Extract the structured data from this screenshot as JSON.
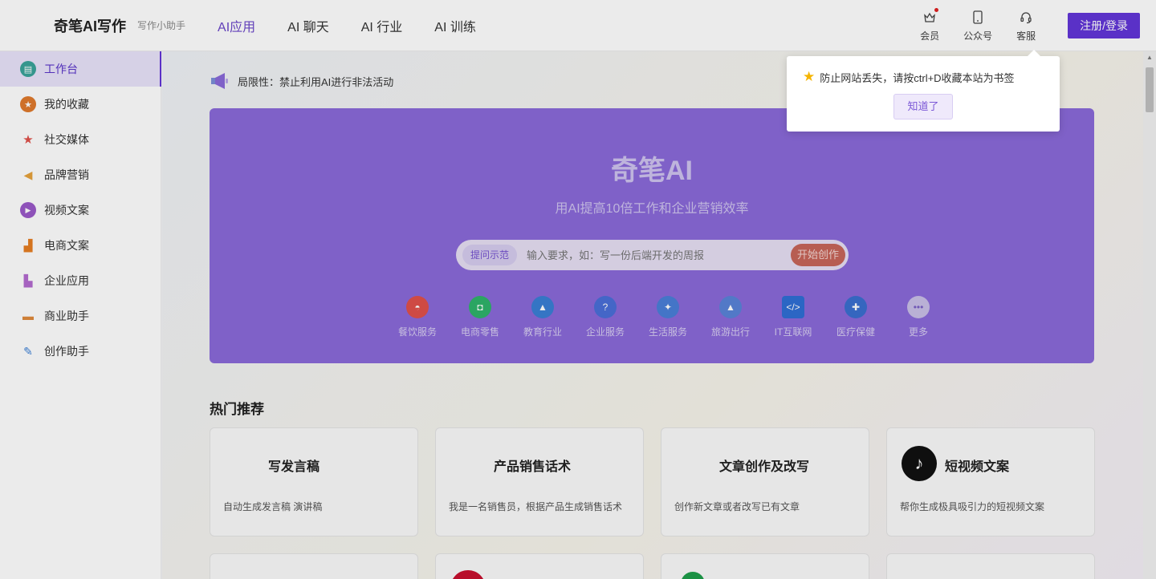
{
  "header": {
    "logo": "奇笔AI写作",
    "logo_sub": "写作小助手",
    "nav": [
      {
        "label": "AI应用",
        "active": true
      },
      {
        "label": "AI 聊天",
        "active": false
      },
      {
        "label": "AI 行业",
        "active": false
      },
      {
        "label": "AI 训练",
        "active": false
      }
    ],
    "icons": [
      {
        "label": "会员",
        "icon": "crown-icon"
      },
      {
        "label": "公众号",
        "icon": "phone-icon"
      },
      {
        "label": "客服",
        "icon": "headset-icon"
      }
    ],
    "login_label": "注册/登录"
  },
  "sidebar": {
    "items": [
      {
        "label": "工作台",
        "icon": "workbench-icon",
        "color": "#3aa39a",
        "active": true
      },
      {
        "label": "我的收藏",
        "icon": "star-icon",
        "color": "#e07a2d"
      },
      {
        "label": "社交媒体",
        "icon": "social-star-icon",
        "color": "#e0514a"
      },
      {
        "label": "品牌营销",
        "icon": "megaphone-icon",
        "color": "#e6a23c"
      },
      {
        "label": "视频文案",
        "icon": "play-icon",
        "color": "#9b59c9"
      },
      {
        "label": "电商文案",
        "icon": "cart-icon",
        "color": "#e67e22"
      },
      {
        "label": "企业应用",
        "icon": "building-icon",
        "color": "#b36bd0"
      },
      {
        "label": "商业助手",
        "icon": "briefcase-icon",
        "color": "#e08a3c"
      },
      {
        "label": "创作助手",
        "icon": "pen-icon",
        "color": "#3a7fd5"
      }
    ]
  },
  "notice": {
    "text": "局限性：禁止利用AI进行非法活动"
  },
  "hero": {
    "title": "奇笔AI",
    "subtitle": "用AI提高10倍工作和企业营销效率",
    "search_tag": "提问示范",
    "search_placeholder": "输入要求，如：写一份后端开发的周报",
    "search_button": "开始创作",
    "categories": [
      {
        "label": "餐饮服务",
        "icon": "dish-icon",
        "color": "#e0514a"
      },
      {
        "label": "电商零售",
        "icon": "bag-icon",
        "color": "#2fb36b"
      },
      {
        "label": "教育行业",
        "icon": "graduation-cap-icon",
        "color": "#3a7fd5"
      },
      {
        "label": "企业服务",
        "icon": "question-icon",
        "color": "#4a6fd8"
      },
      {
        "label": "生活服务",
        "icon": "mic-icon",
        "color": "#4a7fd8"
      },
      {
        "label": "旅游出行",
        "icon": "mountain-icon",
        "color": "#5a84d8"
      },
      {
        "label": "IT互联网",
        "icon": "code-icon",
        "color": "#2f6fd5"
      },
      {
        "label": "医疗保健",
        "icon": "hospital-icon",
        "color": "#3a6fd0"
      },
      {
        "label": "更多",
        "icon": "more-icon",
        "color": "#c9bfe8"
      }
    ]
  },
  "hot": {
    "title": "热门推荐",
    "cards": [
      {
        "title": "写发言稿",
        "desc": "自动生成发言稿 演讲稿"
      },
      {
        "title": "产品销售话术",
        "desc": "我是一名销售员，根据产品生成销售话术"
      },
      {
        "title": "文章创作及改写",
        "desc": "创作新文章或者改写已有文章"
      },
      {
        "title": "短视频文案",
        "desc": "帮你生成极具吸引力的短视频文案",
        "icon": "tiktok-icon"
      }
    ]
  },
  "popup": {
    "message": "防止网站丢失，请按ctrl+D收藏本站为书签",
    "button": "知道了"
  }
}
